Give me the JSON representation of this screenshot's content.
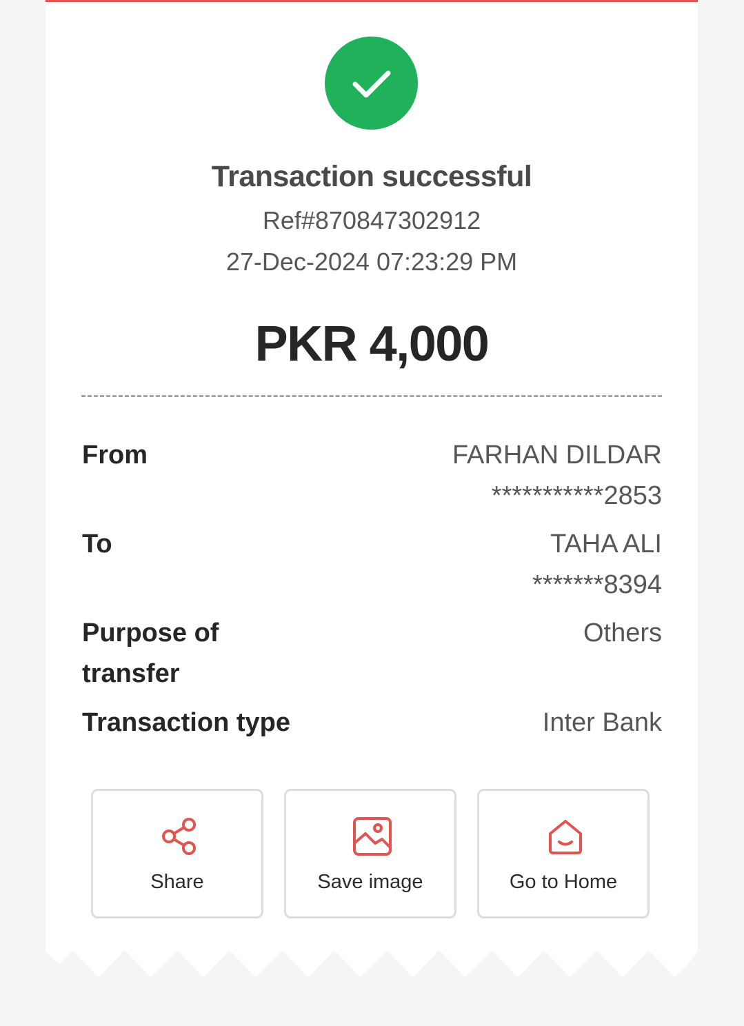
{
  "colors": {
    "accent": "#e3534f",
    "success": "#20b15a",
    "text_primary": "#262628",
    "text_secondary": "#55565a",
    "background": "#f5f5f6"
  },
  "header": {
    "status_icon": "check-icon",
    "title": "Transaction successful",
    "reference": "Ref#870847302912",
    "datetime": "27-Dec-2024 07:23:29 PM"
  },
  "amount": "PKR 4,000",
  "details": {
    "from": {
      "label": "From",
      "name": "FARHAN DILDAR",
      "account": "***********2853"
    },
    "to": {
      "label": "To",
      "name": "TAHA ALI",
      "account": "*******8394"
    },
    "purpose": {
      "label_line1": "Purpose of",
      "label_line2": "transfer",
      "value": "Others"
    },
    "type": {
      "label": "Transaction type",
      "value": "Inter Bank"
    }
  },
  "actions": [
    {
      "label": "Share",
      "icon": "share-icon"
    },
    {
      "label": "Save image",
      "icon": "image-icon"
    },
    {
      "label": "Go to Home",
      "icon": "home-icon"
    }
  ]
}
